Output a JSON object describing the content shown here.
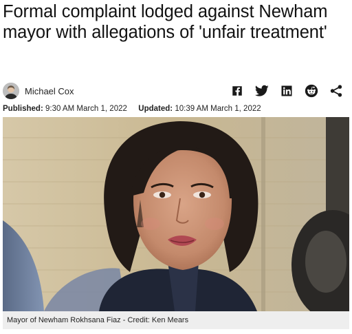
{
  "article": {
    "headline": "Formal complaint lodged against Newham mayor with allegations of 'unfair treatment'",
    "author": "Michael Cox",
    "published_label": "Published:",
    "published_value": "9:30 AM March 1, 2022",
    "updated_label": "Updated:",
    "updated_value": "10:39 AM March 1, 2022"
  },
  "share_icons": [
    "facebook-icon",
    "twitter-icon",
    "linkedin-icon",
    "reddit-icon",
    "share-icon"
  ],
  "photo": {
    "caption": "Mayor of Newham Rokhsana Fiaz - Credit: Ken Mears"
  },
  "colors": {
    "headline": "#111111",
    "icons": "#1a1a1a",
    "caption_bg": "#eeeeee"
  }
}
